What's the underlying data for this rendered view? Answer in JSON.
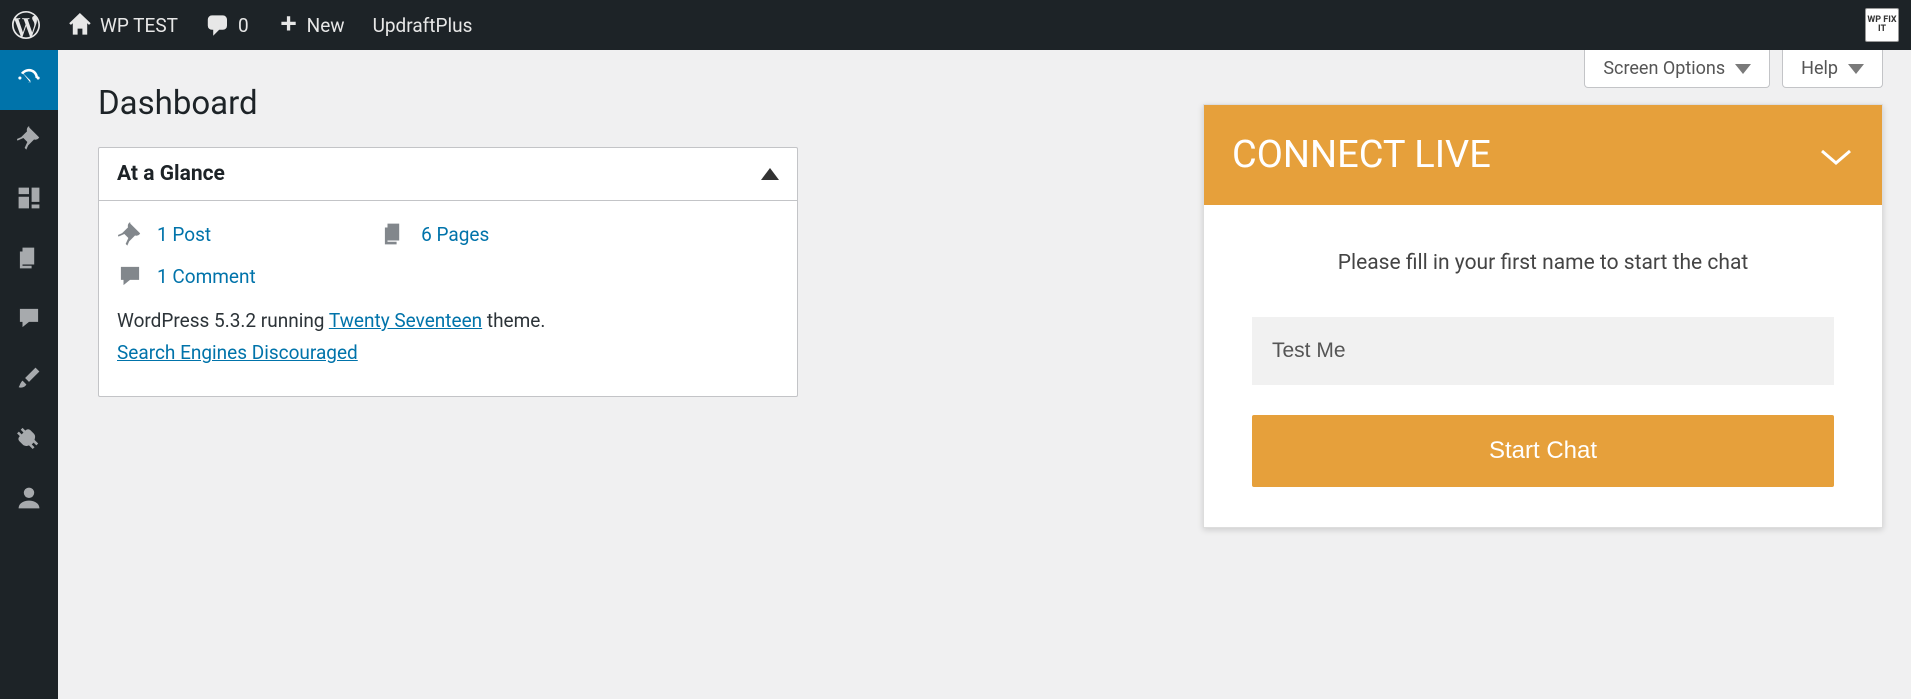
{
  "adminbar": {
    "site_name": "WP TEST",
    "comments_count": "0",
    "new_label": "New",
    "updraft_label": "UpdraftPlus",
    "wpfixit_label": "WP FIX IT"
  },
  "screen_meta": {
    "options_label": "Screen Options",
    "help_label": "Help"
  },
  "page": {
    "title": "Dashboard"
  },
  "glance": {
    "title": "At a Glance",
    "posts": "1 Post",
    "pages": "6 Pages",
    "comments": "1 Comment",
    "version_prefix": "WordPress 5.3.2 running ",
    "theme_link": "Twenty Seventeen",
    "theme_suffix": " theme.",
    "search_engines": "Search Engines Discouraged"
  },
  "connect": {
    "header": "CONNECT LIVE",
    "message": "Please fill in your first name to start the chat",
    "input_value": "Test Me",
    "button": "Start Chat"
  }
}
